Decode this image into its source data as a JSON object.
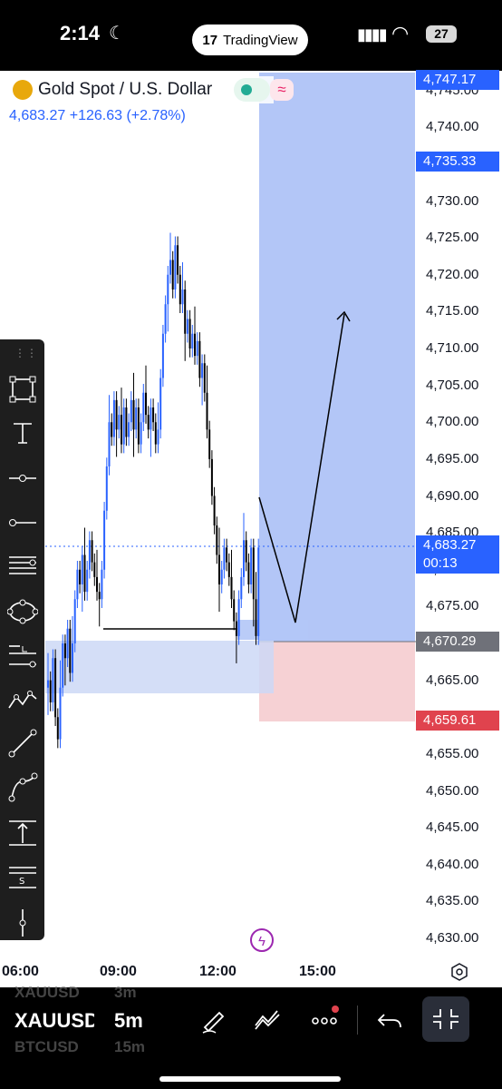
{
  "status_bar": {
    "time": "2:14",
    "app_pill": "TradingView",
    "battery": "27"
  },
  "symbol": {
    "title": "Gold Spot / U.S. Dollar",
    "last": "4,683.27",
    "change": "+126.63",
    "change_pct": "(+2.78%)"
  },
  "price_axis": {
    "labels": [
      "4,745.00",
      "4,740.00",
      "4,730.00",
      "4,725.00",
      "4,720.00",
      "4,715.00",
      "4,710.00",
      "4,705.00",
      "4,700.00",
      "4,695.00",
      "4,690.00",
      "4,685.00",
      "4,680.00",
      "4,675.00",
      "4,665.00",
      "4,655.00",
      "4,650.00",
      "4,645.00",
      "4,640.00",
      "4,635.00",
      "4,630.00"
    ],
    "tags": {
      "target_top": "4,747.17",
      "target_level": "4,735.33",
      "current": "4,683.27",
      "countdown": "00:13",
      "entry": "4,670.29",
      "stop": "4,659.61"
    }
  },
  "time_axis": [
    "06:00",
    "09:00",
    "12:00",
    "15:00"
  ],
  "bottom_bar": {
    "symbols": [
      "XAUUSD",
      "XAUUSD",
      "BTCUSD"
    ],
    "intervals": [
      "3m",
      "5m",
      "15m"
    ]
  },
  "colors": {
    "accent": "#2962ff",
    "up": "#2962ff",
    "down": "#000000",
    "profit_zone": "#b3c6f7",
    "loss_zone": "#f6d1d4",
    "tag_blue": "#2962ff",
    "tag_red": "#e0434e",
    "tag_grey": "#6f7179"
  }
}
